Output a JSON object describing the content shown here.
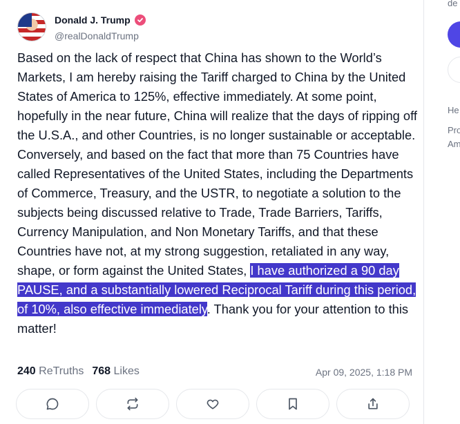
{
  "post": {
    "author_name": "Donald J. Trump",
    "handle": "@realDonaldTrump",
    "text_before": "Based on the lack of respect that China has shown to the World’s Markets, I am hereby raising the Tariff charged to China by the United States of America to 125%, effective immediately. At some point, hopefully in the near future, China will realize that the days of ripping off the U.S.A., and other Countries, is no longer sustainable or acceptable. Conversely, and based on the fact that more than 75 Countries have called Representatives of the United States, including the Departments of Commerce, Treasury, and the USTR, to negotiate a solution to the subjects being discussed relative to Trade, Trade Barriers, Tariffs, Currency Manipulation, and Non Monetary Tariffs, and that these Countries have not, at my strong suggestion, retaliated in any way, shape, or form against the United States, ",
    "text_highlight": "I have authorized a 90 day PAUSE, and a substantially lowered Reciprocal Tariff during this period, of 10%, also effective immediately",
    "text_after": ". Thank you for your attention to this matter!",
    "retruths_count": "240",
    "retruths_label": "ReTruths",
    "likes_count": "768",
    "likes_label": "Likes",
    "timestamp": "Apr 09, 2025, 1:18 PM",
    "highlight_color": "#4338ca",
    "verified_color": "#ec4e7a"
  },
  "actions": [
    {
      "icon": "reply-icon"
    },
    {
      "icon": "retruth-icon"
    },
    {
      "icon": "like-icon"
    },
    {
      "icon": "bookmark-icon"
    },
    {
      "icon": "share-icon"
    }
  ],
  "sidebar": {
    "top_text": "de",
    "line1": "He",
    "line2": "Pro",
    "line3": "Am",
    "accent_color": "#4f46e5"
  }
}
